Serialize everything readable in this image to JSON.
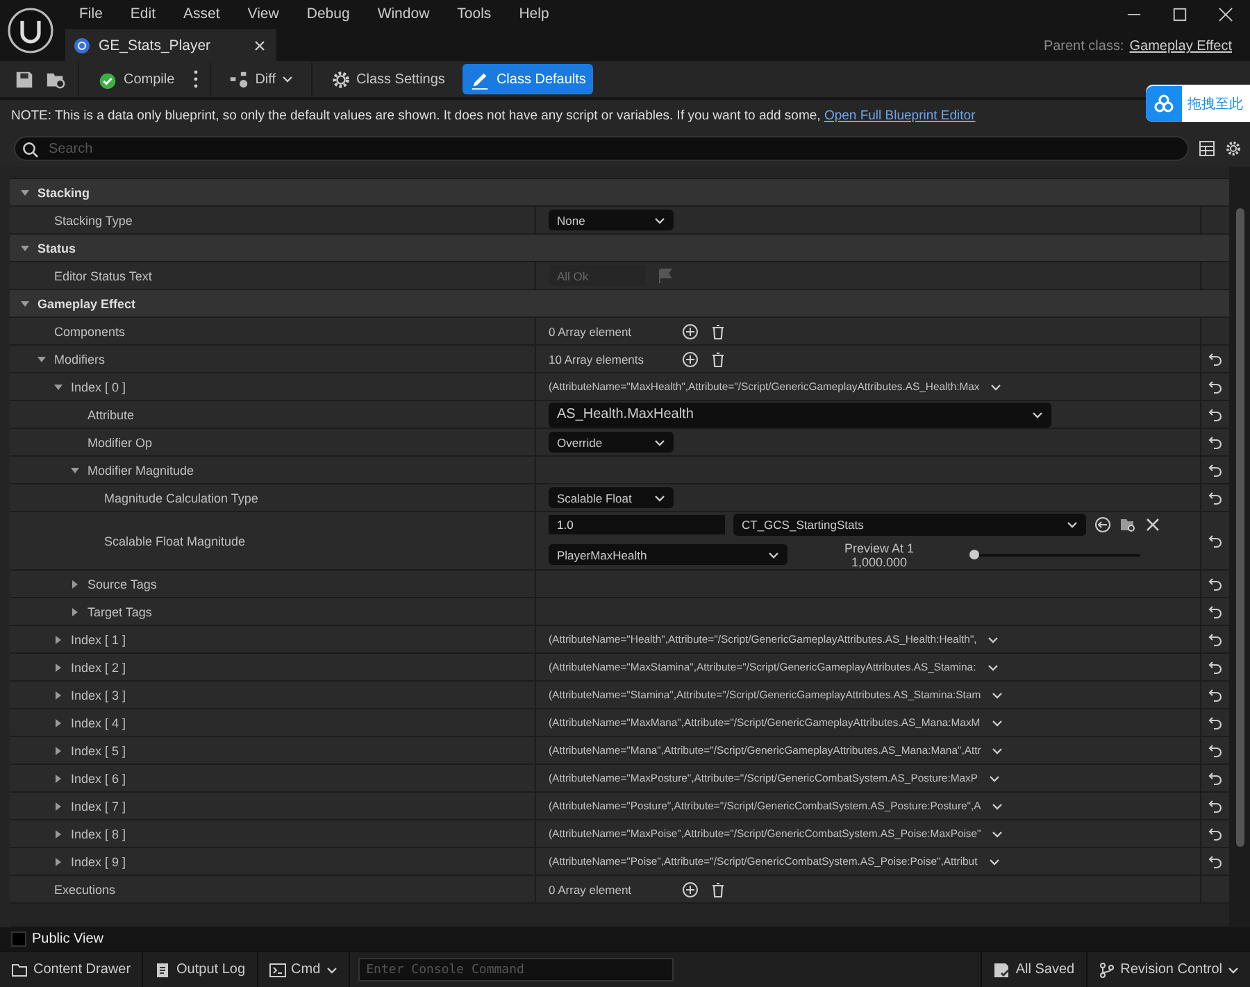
{
  "menu": [
    "File",
    "Edit",
    "Asset",
    "View",
    "Debug",
    "Window",
    "Tools",
    "Help"
  ],
  "tab": {
    "title": "GE_Stats_Player"
  },
  "parent_class": {
    "label": "Parent class:",
    "value": "Gameplay Effect"
  },
  "toolbar": {
    "compile": "Compile",
    "diff": "Diff",
    "modes": [
      {
        "label": "Class Settings",
        "selected": false
      },
      {
        "label": "Class Defaults",
        "selected": true
      }
    ]
  },
  "note": {
    "text": "NOTE: This is a data only blueprint, so only the default values are shown.  It does not have any script or variables.  If you want to add some,",
    "link": "Open Full Blueprint Editor"
  },
  "overlay": {
    "text": "拖拽至此"
  },
  "search": {
    "placeholder": "Search"
  },
  "details": {
    "rows": [
      {
        "kind": "category",
        "label": "Stacking",
        "expanded": true,
        "children": [
          {
            "label": "Stacking Type",
            "resettable": false,
            "value": {
              "kind": "dropdown",
              "text": "None"
            }
          }
        ]
      },
      {
        "kind": "category",
        "label": "Status",
        "expanded": true,
        "children": [
          {
            "label": "Editor Status Text",
            "resettable": false,
            "value": {
              "kind": "readonly",
              "text": "All Ok"
            }
          }
        ]
      },
      {
        "kind": "category",
        "label": "Gameplay Effect",
        "expanded": true,
        "children": [
          {
            "label": "Components",
            "resettable": false,
            "value": {
              "kind": "array",
              "text": "0 Array element"
            }
          },
          {
            "label": "Modifiers",
            "resettable": true,
            "expanded": true,
            "value": {
              "kind": "array",
              "text": "10 Array elements"
            },
            "children": [
              {
                "label": "Index [ 0 ]",
                "resettable": true,
                "expanded": true,
                "value": {
                  "kind": "struct",
                  "text": "(AttributeName=\"MaxHealth\",Attribute=\"/Script/GenericGameplayAttributes.AS_Health:Max"
                },
                "children": [
                  {
                    "label": "Attribute",
                    "resettable": true,
                    "value": {
                      "kind": "wide-dropdown",
                      "text": "AS_Health.MaxHealth"
                    }
                  },
                  {
                    "label": "Modifier Op",
                    "resettable": true,
                    "value": {
                      "kind": "dropdown",
                      "text": "Override"
                    }
                  },
                  {
                    "label": "Modifier Magnitude",
                    "resettable": true,
                    "expanded": true,
                    "children": [
                      {
                        "label": "Magnitude Calculation Type",
                        "resettable": true,
                        "value": {
                          "kind": "dropdown",
                          "text": "Scalable Float"
                        }
                      },
                      {
                        "label": "Scalable Float Magnitude",
                        "resettable": true,
                        "value": {
                          "kind": "scalable",
                          "number": "1.0",
                          "table": "CT_GCS_StartingStats",
                          "row_name": "PlayerMaxHealth",
                          "preview_label": "Preview At 1",
                          "preview_value": "1,000.000",
                          "level": 0
                        }
                      }
                    ]
                  },
                  {
                    "label": "Source Tags",
                    "resettable": true,
                    "expanded": false
                  },
                  {
                    "label": "Target Tags",
                    "resettable": true,
                    "expanded": false
                  }
                ]
              },
              {
                "label": "Index [ 1 ]",
                "resettable": true,
                "expanded": false,
                "value": {
                  "kind": "struct",
                  "text": "(AttributeName=\"Health\",Attribute=\"/Script/GenericGameplayAttributes.AS_Health:Health\","
                }
              },
              {
                "label": "Index [ 2 ]",
                "resettable": true,
                "expanded": false,
                "value": {
                  "kind": "struct",
                  "text": "(AttributeName=\"MaxStamina\",Attribute=\"/Script/GenericGameplayAttributes.AS_Stamina:"
                }
              },
              {
                "label": "Index [ 3 ]",
                "resettable": true,
                "expanded": false,
                "value": {
                  "kind": "struct",
                  "text": "(AttributeName=\"Stamina\",Attribute=\"/Script/GenericGameplayAttributes.AS_Stamina:Stam"
                }
              },
              {
                "label": "Index [ 4 ]",
                "resettable": true,
                "expanded": false,
                "value": {
                  "kind": "struct",
                  "text": "(AttributeName=\"MaxMana\",Attribute=\"/Script/GenericGameplayAttributes.AS_Mana:MaxM"
                }
              },
              {
                "label": "Index [ 5 ]",
                "resettable": true,
                "expanded": false,
                "value": {
                  "kind": "struct",
                  "text": "(AttributeName=\"Mana\",Attribute=\"/Script/GenericGameplayAttributes.AS_Mana:Mana\",Attr"
                }
              },
              {
                "label": "Index [ 6 ]",
                "resettable": true,
                "expanded": false,
                "value": {
                  "kind": "struct",
                  "text": "(AttributeName=\"MaxPosture\",Attribute=\"/Script/GenericCombatSystem.AS_Posture:MaxP"
                }
              },
              {
                "label": "Index [ 7 ]",
                "resettable": true,
                "expanded": false,
                "value": {
                  "kind": "struct",
                  "text": "(AttributeName=\"Posture\",Attribute=\"/Script/GenericCombatSystem.AS_Posture:Posture\",A"
                }
              },
              {
                "label": "Index [ 8 ]",
                "resettable": true,
                "expanded": false,
                "value": {
                  "kind": "struct",
                  "text": "(AttributeName=\"MaxPoise\",Attribute=\"/Script/GenericCombatSystem.AS_Poise:MaxPoise\""
                }
              },
              {
                "label": "Index [ 9 ]",
                "resettable": true,
                "expanded": false,
                "value": {
                  "kind": "struct",
                  "text": "(AttributeName=\"Poise\",Attribute=\"/Script/GenericCombatSystem.AS_Poise:Poise\",Attribut"
                }
              }
            ]
          },
          {
            "label": "Executions",
            "resettable": false,
            "value": {
              "kind": "array",
              "text": "0 Array element"
            }
          }
        ]
      }
    ]
  },
  "public_view": {
    "label": "Public View",
    "checked": false
  },
  "status_bar": {
    "content_drawer": "Content Drawer",
    "output_log": "Output Log",
    "cmd": "Cmd",
    "console_placeholder": "Enter Console Command",
    "all_saved": "All Saved",
    "revision_control": "Revision Control"
  }
}
